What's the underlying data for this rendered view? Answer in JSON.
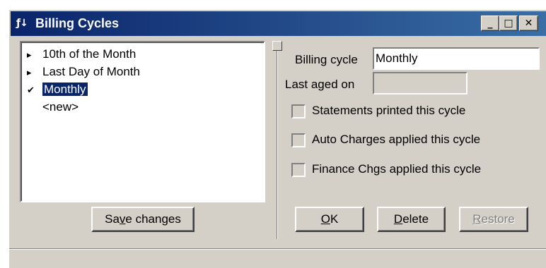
{
  "window": {
    "title": "Billing Cycles",
    "app_icon": "ƒ↓",
    "controls": {
      "minimize": "_",
      "maximize": "□",
      "close": "✕"
    }
  },
  "list": {
    "items": [
      {
        "marker": "▸",
        "label": "10th of the Month"
      },
      {
        "marker": "▸",
        "label": "Last Day of Month"
      },
      {
        "marker": "✔",
        "label": "Monthly",
        "selected": true
      },
      {
        "marker": "",
        "label": "<new>"
      }
    ]
  },
  "form": {
    "billing_cycle_label": "Billing cycle",
    "billing_cycle_value": "Monthly",
    "last_aged_label": "Last aged on",
    "last_aged_value": "",
    "checkboxes": [
      {
        "label": "Statements printed this cycle",
        "checked": false
      },
      {
        "label": "Auto Charges applied this cycle",
        "checked": false
      },
      {
        "label": "Finance Chgs applied this cycle",
        "checked": false
      }
    ]
  },
  "buttons": {
    "save_pre": "Sa",
    "save_accel": "v",
    "save_post": "e changes",
    "ok_accel": "O",
    "ok_post": "K",
    "delete_accel": "D",
    "delete_post": "elete",
    "restore_accel": "R",
    "restore_post": "estore"
  },
  "status": {
    "text": ""
  }
}
